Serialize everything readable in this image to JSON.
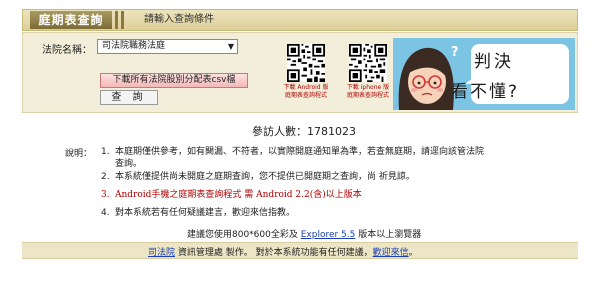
{
  "header": {
    "title": "庭期表查詢",
    "prompt": "請輸入查詢條件"
  },
  "form": {
    "court_label": "法院名稱：",
    "court_selected": "司法院職務法庭",
    "download_csv_label": "下載所有法院股別分配表csv檔",
    "query_label": "查 詢"
  },
  "apps": {
    "android_label_1": "下載 Android 版",
    "android_label_2": "庭期表查詢程式",
    "iphone_label_1": "下載 iphone 版",
    "iphone_label_2": "庭期表查詢程式"
  },
  "banner": {
    "line1": "判決",
    "line2": "看不懂?"
  },
  "visitor": {
    "label": "參訪人數：",
    "count": "1781023"
  },
  "notes": {
    "label": "說明：",
    "items": [
      {
        "num": "1.",
        "text": "本庭期僅供參考，如有闕漏、不符者，以實際開庭通知單為準，若查無庭期，請逕向該管法院查詢。"
      },
      {
        "num": "2.",
        "text": "本系統僅提供尚未開庭之庭期查詢，您不提供已開庭期之查詢，尚 祈見諒。"
      },
      {
        "num": "3.",
        "text": "Android手機之庭期表查詢程式 需 Android 2.2(含)以上版本"
      },
      {
        "num": "4.",
        "text": "對本系統若有任何疑議建言，歡迎來信指教。"
      }
    ]
  },
  "browser_note": {
    "prefix": "建議您使用800*600全彩及 ",
    "link": "Explorer 5.5",
    "suffix": " 版本以上瀏覽器"
  },
  "footer": {
    "org_link": "司法院",
    "middle": " 資訊管理處 製作。 對於本系統功能有任何建議，",
    "contact_link": "歡迎來信",
    "end": "。"
  },
  "colors": {
    "header_bg": "#ded09a",
    "title_bg": "#7b6b35",
    "panel_bg": "#f2eed9",
    "alert_red": "#b00000",
    "link_blue": "#1a3fb0",
    "banner_blue": "#7cc4e4"
  }
}
